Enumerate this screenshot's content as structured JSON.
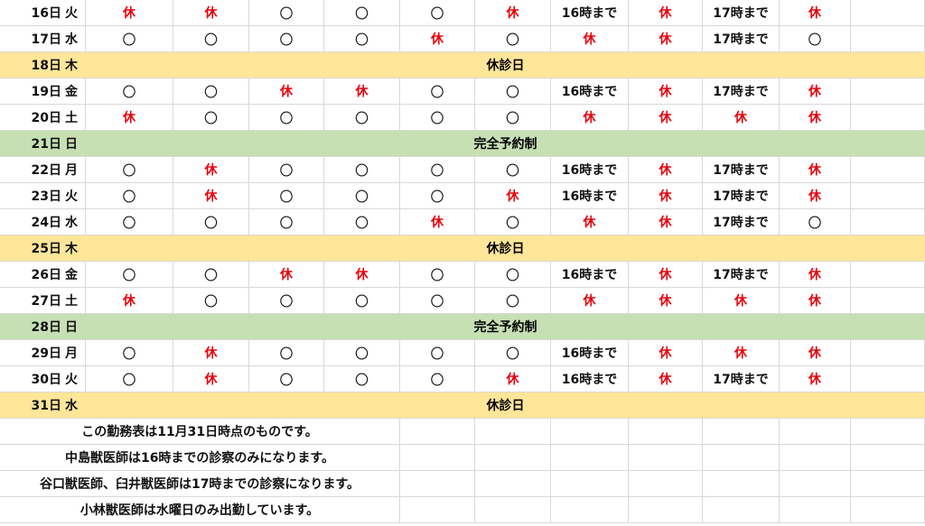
{
  "colors": {
    "rest": "#e8000b",
    "closed_band": "#ffe699",
    "reserve_band": "#c6e0b4",
    "grid": "#d9d9d9"
  },
  "rows": [
    {
      "date": "16日",
      "dow": "火",
      "cells": [
        "休",
        "休",
        "〇",
        "〇",
        "〇",
        "休",
        "16時まで",
        "休",
        "17時まで",
        "休"
      ]
    },
    {
      "date": "17日",
      "dow": "水",
      "cells": [
        "〇",
        "〇",
        "〇",
        "〇",
        "休",
        "〇",
        "休",
        "休",
        "17時まで",
        "〇"
      ]
    },
    {
      "date": "18日",
      "dow": "木",
      "band": "休診日",
      "kind": "closed"
    },
    {
      "date": "19日",
      "dow": "金",
      "cells": [
        "〇",
        "〇",
        "休",
        "休",
        "〇",
        "〇",
        "16時まで",
        "休",
        "17時まで",
        "休"
      ]
    },
    {
      "date": "20日",
      "dow": "土",
      "cells": [
        "休",
        "〇",
        "〇",
        "〇",
        "〇",
        "〇",
        "休",
        "休",
        "休",
        "休"
      ]
    },
    {
      "date": "21日",
      "dow": "日",
      "band": "完全予約制",
      "kind": "reserve"
    },
    {
      "date": "22日",
      "dow": "月",
      "cells": [
        "〇",
        "休",
        "〇",
        "〇",
        "〇",
        "〇",
        "16時まで",
        "休",
        "17時まで",
        "休"
      ]
    },
    {
      "date": "23日",
      "dow": "火",
      "cells": [
        "〇",
        "休",
        "〇",
        "〇",
        "〇",
        "休",
        "16時まで",
        "休",
        "17時まで",
        "休"
      ]
    },
    {
      "date": "24日",
      "dow": "水",
      "cells": [
        "〇",
        "〇",
        "〇",
        "〇",
        "休",
        "〇",
        "休",
        "休",
        "17時まで",
        "〇"
      ]
    },
    {
      "date": "25日",
      "dow": "木",
      "band": "休診日",
      "kind": "closed"
    },
    {
      "date": "26日",
      "dow": "金",
      "cells": [
        "〇",
        "〇",
        "休",
        "休",
        "〇",
        "〇",
        "16時まで",
        "休",
        "17時まで",
        "休"
      ]
    },
    {
      "date": "27日",
      "dow": "土",
      "cells": [
        "休",
        "〇",
        "〇",
        "〇",
        "〇",
        "〇",
        "休",
        "休",
        "休",
        "休"
      ]
    },
    {
      "date": "28日",
      "dow": "日",
      "band": "完全予約制",
      "kind": "reserve"
    },
    {
      "date": "29日",
      "dow": "月",
      "cells": [
        "〇",
        "休",
        "〇",
        "〇",
        "〇",
        "〇",
        "16時まで",
        "休",
        "休",
        "休"
      ]
    },
    {
      "date": "30日",
      "dow": "火",
      "cells": [
        "〇",
        "休",
        "〇",
        "〇",
        "〇",
        "休",
        "16時まで",
        "休",
        "17時まで",
        "休"
      ]
    },
    {
      "date": "31日",
      "dow": "水",
      "band": "休診日",
      "kind": "closed"
    }
  ],
  "notes": [
    "この勤務表は11月31日時点のものです。",
    "中島獣医師は16時までの診察のみになります。",
    "谷口獣医師、臼井獣医師は17時までの診察になります。",
    "小林獣医師は水曜日のみ出勤しています。"
  ]
}
